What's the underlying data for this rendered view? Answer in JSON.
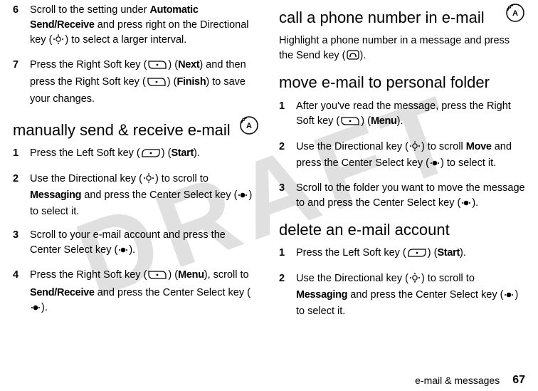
{
  "watermark": "DRAFT",
  "left": {
    "step6": {
      "num": "6",
      "text_a": "Scroll to the setting under ",
      "auto": "Automatic Send/Receive",
      "text_b": " and press right on the Directional key (",
      "text_c": ") to select a larger interval."
    },
    "step7": {
      "num": "7",
      "text_a": "Press the Right Soft key (",
      "text_b": ") (",
      "next": "Next",
      "text_c": ") and then press the Right Soft key (",
      "text_d": ") (",
      "finish": "Finish",
      "text_e": ") to save your changes."
    },
    "heading1": "manually send & receive e-mail",
    "m1": {
      "num": "1",
      "a": "Press the Left Soft key (",
      "b": ") (",
      "start": "Start",
      "c": ")."
    },
    "m2": {
      "num": "2",
      "a": "Use the Directional key (",
      "b": ") to scroll to ",
      "messaging": "Messaging",
      "c": " and press the Center Select key (",
      "d": ") to select it."
    },
    "m3": {
      "num": "3",
      "a": "Scroll to your e-mail account and press the Center Select key (",
      "b": ")."
    },
    "m4": {
      "num": "4",
      "a": "Press the Right Soft key (",
      "b": ") (",
      "menu": "Menu",
      "c": "), scroll to ",
      "sendrecv": "Send/Receive",
      "d": " and press the Center Select key (",
      "e": ")."
    }
  },
  "right": {
    "heading1": "call a phone number in e-mail",
    "intro1": {
      "a": "Highlight a phone number in a message and press the Send key (",
      "b": ")."
    },
    "heading2": "move e-mail to personal folder",
    "p1": {
      "num": "1",
      "a": "After you've read the message, press the Right Soft key (",
      "b": ") (",
      "menu": "Menu",
      "c": ")."
    },
    "p2": {
      "num": "2",
      "a": "Use the Directional key (",
      "b": ") to scroll ",
      "move": "Move",
      "c": " and press the Center Select key (",
      "d": ") to select it."
    },
    "p3": {
      "num": "3",
      "a": "Scroll to the folder you want to move the message to and press the Center Select key (",
      "b": ")."
    },
    "heading3": "delete an e-mail account",
    "d1": {
      "num": "1",
      "a": "Press the Left Soft key (",
      "b": ") (",
      "start": "Start",
      "c": ")."
    },
    "d2": {
      "num": "2",
      "a": "Use the Directional key (",
      "b": ") to scroll to ",
      "messaging": "Messaging",
      "c": " and press the Center Select key (",
      "d": ") to select it."
    }
  },
  "footer": {
    "section": "e-mail & messages",
    "page": "67"
  }
}
